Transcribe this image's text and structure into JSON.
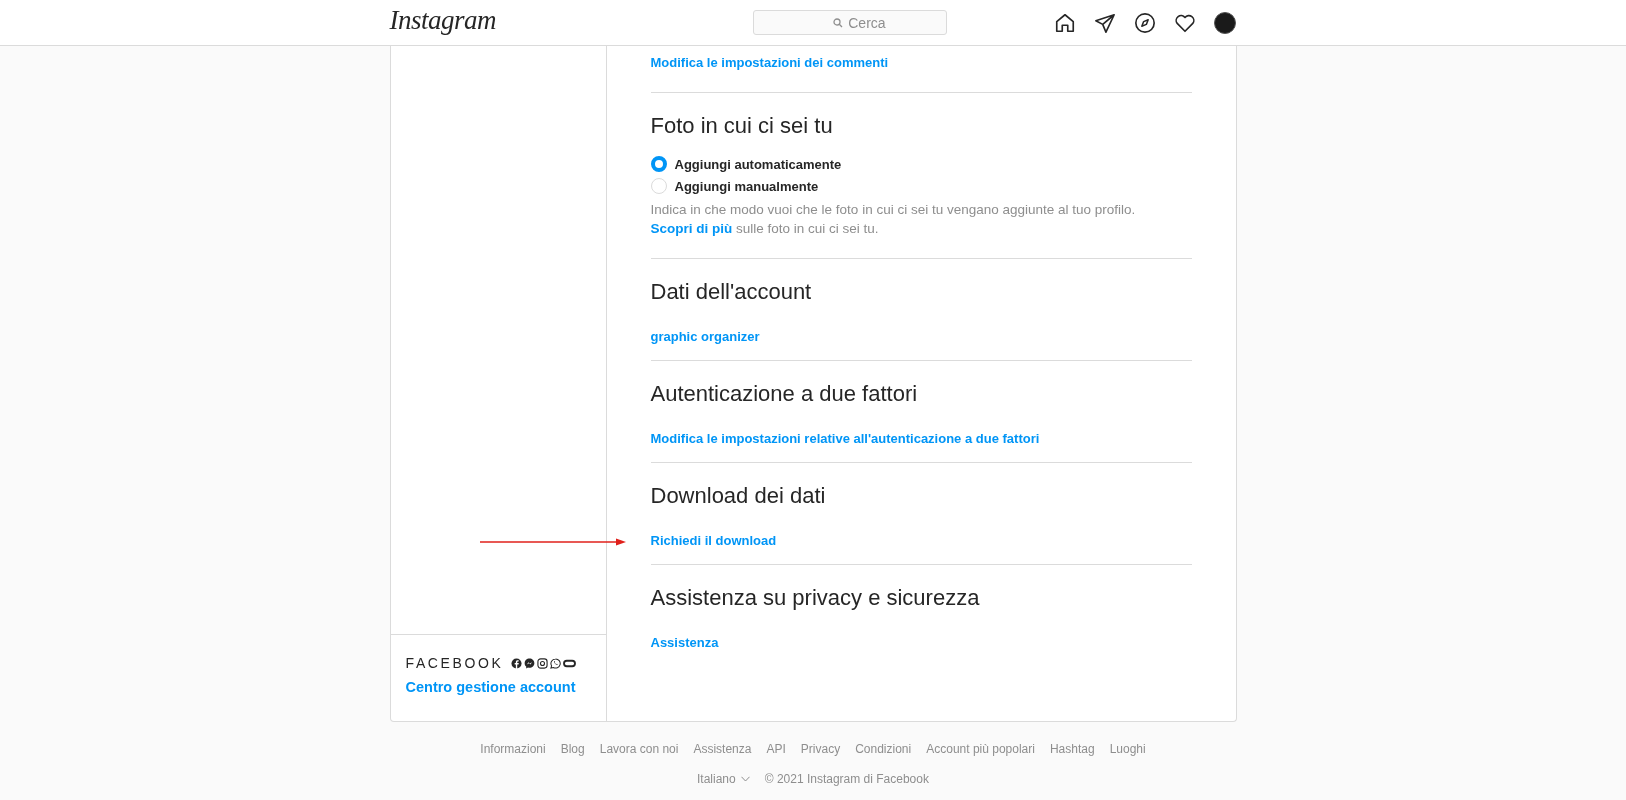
{
  "header": {
    "logo": "Instagram",
    "search": {
      "placeholder": "Cerca"
    }
  },
  "sidebar": {
    "brand": "FACEBOOK",
    "link": "Centro gestione account"
  },
  "sections": [
    {
      "kind": "link",
      "link": "Modifica le impostazioni dei commenti"
    },
    {
      "kind": "radio",
      "title": "Foto in cui ci sei tu",
      "options": [
        {
          "label": "Aggiungi automaticamente",
          "selected": true
        },
        {
          "label": "Aggiungi manualmente",
          "selected": false
        }
      ],
      "description": {
        "before": "Indica in che modo vuoi che le foto in cui ci sei tu vengano aggiunte al tuo profilo.",
        "link": "Scopri di più",
        "after": "sulle foto in cui ci sei tu."
      }
    },
    {
      "kind": "link",
      "title": "Dati dell'account",
      "link": "graphic organizer"
    },
    {
      "kind": "link",
      "title": "Autenticazione a due fattori",
      "link": "Modifica le impostazioni relative all'autenticazione a due fattori"
    },
    {
      "kind": "link",
      "title": "Download dei dati",
      "link": "Richiedi il download"
    },
    {
      "kind": "link",
      "title": "Assistenza su privacy e sicurezza",
      "link": "Assistenza"
    }
  ],
  "footer": {
    "links": [
      "Informazioni",
      "Blog",
      "Lavora con noi",
      "Assistenza",
      "API",
      "Privacy",
      "Condizioni",
      "Account più popolari",
      "Hashtag",
      "Luoghi"
    ],
    "language": "Italiano",
    "copyright": "© 2021 Instagram di Facebook"
  }
}
